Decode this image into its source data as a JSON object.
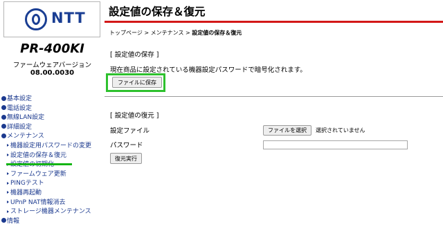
{
  "brand": {
    "logo_text": "NTT",
    "logo_color": "#1a3e93",
    "icon": "ntt-logo-icon"
  },
  "device": {
    "model": "PR-400KI",
    "firmware_label": "ファームウェアバージョン",
    "firmware_version": "08.00.0030"
  },
  "nav": {
    "items": [
      {
        "label": "基本設定",
        "level": 1
      },
      {
        "label": "電話設定",
        "level": 1
      },
      {
        "label": "無線LAN設定",
        "level": 1
      },
      {
        "label": "詳細設定",
        "level": 1
      },
      {
        "label": "メンテナンス",
        "level": 1
      },
      {
        "label": "機器設定用パスワードの変更",
        "level": 2
      },
      {
        "label": "設定値の保存＆復元",
        "level": 2,
        "active": true
      },
      {
        "label": "設定値の初期化",
        "level": 2
      },
      {
        "label": "ファームウェア更新",
        "level": 2
      },
      {
        "label": "PINGテスト",
        "level": 2
      },
      {
        "label": "機器再起動",
        "level": 2
      },
      {
        "label": "UPnP NAT情報消去",
        "level": 2
      },
      {
        "label": "ストレージ機器メンテナンス",
        "level": 2
      },
      {
        "label": "情報",
        "level": 1
      }
    ],
    "link_color": "#1c3a8f",
    "highlight_color": "#14b514"
  },
  "header": {
    "title": "設定値の保存＆復元",
    "rule_color": "#d31818"
  },
  "breadcrumb": {
    "top": "トップページ",
    "sep1": " > ",
    "maintenance": "メンテナンス",
    "sep2": " > ",
    "current": "設定値の保存＆復元"
  },
  "save_section": {
    "title": "[ 設定値の保存 ]",
    "description": "現在商品に設定されている機器設定パスワードで暗号化されます。",
    "save_button_label": "ファイルに保存",
    "highlight_color": "#2ec12e"
  },
  "restore_section": {
    "title": "[ 設定値の復元 ]",
    "file_label": "設定ファイル",
    "file_button_label": "ファイルを選択",
    "file_status": "選択されていません",
    "password_label": "パスワード",
    "password_value": "",
    "restore_button_label": "復元実行"
  }
}
